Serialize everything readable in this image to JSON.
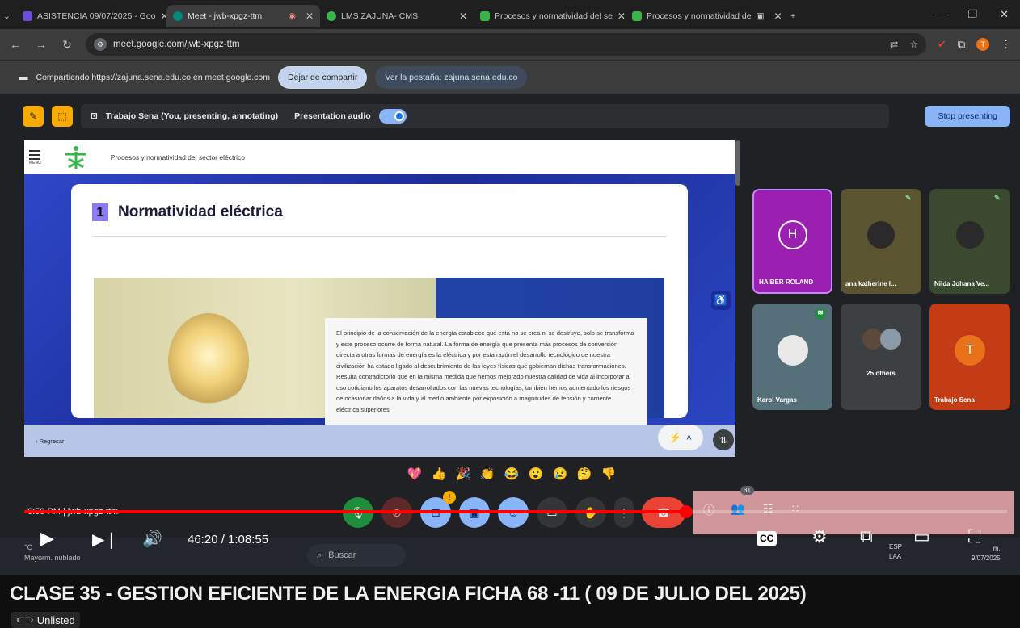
{
  "browser": {
    "tabs": [
      {
        "label": "ASISTENCIA 09/07/2025 - Goo",
        "icon": "sheets-icon",
        "color": "#6b4fd8"
      },
      {
        "label": "Meet - jwb-xpgz-ttm",
        "icon": "meet-icon",
        "color": "#00897b",
        "recording": "◉"
      },
      {
        "label": "LMS ZAJUNA- CMS",
        "icon": "lms-icon",
        "color": "#39b54a"
      },
      {
        "label": "Procesos y normatividad del se",
        "icon": "sena-icon",
        "color": "#39b54a"
      },
      {
        "label": "Procesos y normatividad de",
        "icon": "sena-icon",
        "color": "#39b54a"
      }
    ],
    "new_tab": "+",
    "url": "meet.google.com/jwb-xpgz-ttm",
    "profile_initial": "T"
  },
  "sharebar": {
    "text": "Compartiendo https://zajuna.sena.edu.co en meet.google.com",
    "stop_label": "Dejar de compartir",
    "view_tab_label": "Ver la pestaña: zajuna.sena.edu.co"
  },
  "meet": {
    "presenting_label": "Trabajo Sena (You, presenting, annotating)",
    "audio_label": "Presentation audio",
    "stop_presenting": "Stop presenting",
    "meeting_info": "6:50 PM  |  jwb-xpgz-ttm",
    "participants": [
      {
        "name": "HAIBER ROLAND",
        "initial": "H",
        "color": "#9b1fb0"
      },
      {
        "name": "ana katherine l...",
        "initial": "",
        "color": "#5a5431"
      },
      {
        "name": "Nilda Johana Ve...",
        "initial": "",
        "color": "#3b4a2e"
      },
      {
        "name": "Karol Vargas",
        "initial": "",
        "color": "#56707a"
      },
      {
        "name": "25 others",
        "initial": "",
        "color": "#3c4043"
      },
      {
        "name": "Trabajo Sena",
        "initial": "T",
        "color": "#c33c16"
      }
    ],
    "people_count": "31",
    "notification_badge": "!"
  },
  "presented_page": {
    "header_title": "Procesos y normatividad del sector eléctrico",
    "menu_label": "MENU",
    "section_number": "1",
    "section_title": "Normatividad eléctrica",
    "body": "El principio de la conservación de la energía establece que esta no se crea ni se destruye, solo se transforma y este proceso ocurre de forma natural. La forma de energía que presenta más procesos de conversión directa a otras formas de energía es la eléctrica y por esta razón el desarrollo tecnológico de nuestra civilización ha estado ligado al descubrimiento de las leyes físicas que gobiernan dichas transformaciones. Resulta contradictorio que en la misma medida que hemos mejorado nuestra calidad de vida al incorporar al uso cotidiano los aparatos desarrollados con las nuevas tecnologías, también hemos aumentado los riesgos de ocasionar daños a la vida y al medio ambiente por exposición a magnitudes de tensión y corriente eléctrica superiores",
    "back_label": "‹ Regresar"
  },
  "reactions": [
    "💖",
    "👍",
    "🎉",
    "👏",
    "😂",
    "😮",
    "😢",
    "🤔",
    "👎"
  ],
  "video": {
    "time": "46:20 / 1:08:55",
    "progress": 0.672,
    "title": "CLASE 35 - GESTION EFICIENTE DE LA ENERGIA FICHA 68 -11 ( 09 DE JULIO DEL 2025)",
    "visibility": "Unlisted"
  },
  "taskbar": {
    "weather_temp": "°C",
    "weather_desc": "Mayorm. nublado",
    "search_label": "Buscar",
    "lang": "ESP",
    "lang2": "LAA",
    "time": "m.",
    "date": "9/07/2025"
  },
  "colors": {
    "accent_red": "#ff0000",
    "meet_blue": "#8ab4f8",
    "sena_green": "#39b54a"
  }
}
